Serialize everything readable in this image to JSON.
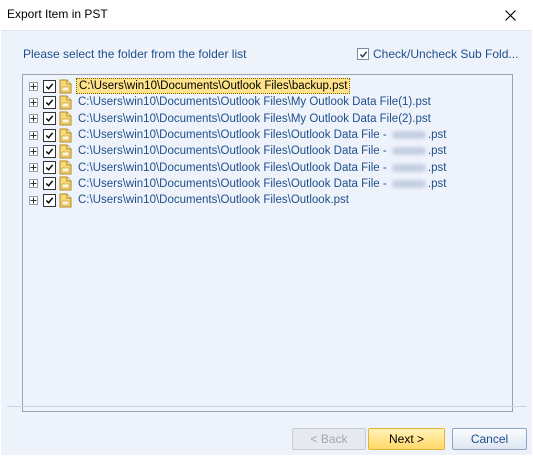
{
  "window": {
    "title": "Export Item in PST"
  },
  "instruction": "Please select the folder from the folder list",
  "subfolder_toggle": {
    "label": "Check/Uncheck Sub Fold...",
    "checked": true
  },
  "tree": {
    "items": [
      {
        "prefix": "C:\\Users\\win10\\Documents\\Outlook Files\\backup.pst",
        "suffix": "",
        "redacted": false,
        "checked": true,
        "selected": true
      },
      {
        "prefix": "C:\\Users\\win10\\Documents\\Outlook Files\\My Outlook Data File(1).pst",
        "suffix": "",
        "redacted": false,
        "checked": true,
        "selected": false
      },
      {
        "prefix": "C:\\Users\\win10\\Documents\\Outlook Files\\My Outlook Data File(2).pst",
        "suffix": "",
        "redacted": false,
        "checked": true,
        "selected": false
      },
      {
        "prefix": "C:\\Users\\win10\\Documents\\Outlook Files\\Outlook Data File - ",
        "suffix": ".pst",
        "redacted": true,
        "checked": true,
        "selected": false
      },
      {
        "prefix": "C:\\Users\\win10\\Documents\\Outlook Files\\Outlook Data File - ",
        "suffix": ".pst",
        "redacted": true,
        "checked": true,
        "selected": false
      },
      {
        "prefix": "C:\\Users\\win10\\Documents\\Outlook Files\\Outlook Data File - ",
        "suffix": ".pst",
        "redacted": true,
        "checked": true,
        "selected": false
      },
      {
        "prefix": "C:\\Users\\win10\\Documents\\Outlook Files\\Outlook Data File - ",
        "suffix": ".pst",
        "redacted": true,
        "checked": true,
        "selected": false
      },
      {
        "prefix": "C:\\Users\\win10\\Documents\\Outlook Files\\Outlook.pst",
        "suffix": "",
        "redacted": false,
        "checked": true,
        "selected": false
      }
    ]
  },
  "buttons": {
    "back": "< Back",
    "next": "Next >",
    "cancel": "Cancel"
  },
  "colors": {
    "accent_text": "#1f4e8c",
    "selection": "#ffe38a",
    "next_button": "#ffd868"
  }
}
